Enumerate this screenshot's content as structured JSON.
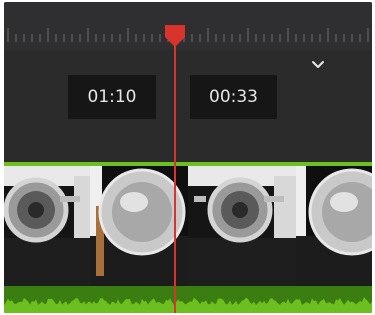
{
  "timecodes": {
    "left": "01:10",
    "right": "00:33"
  },
  "colors": {
    "playhead": "#d7352c",
    "clip_border": "#6cbf1f",
    "audio": "#6cbf1f"
  },
  "icons": {
    "dropdown": "chevron-down-icon",
    "playhead": "playhead-marker-icon"
  }
}
